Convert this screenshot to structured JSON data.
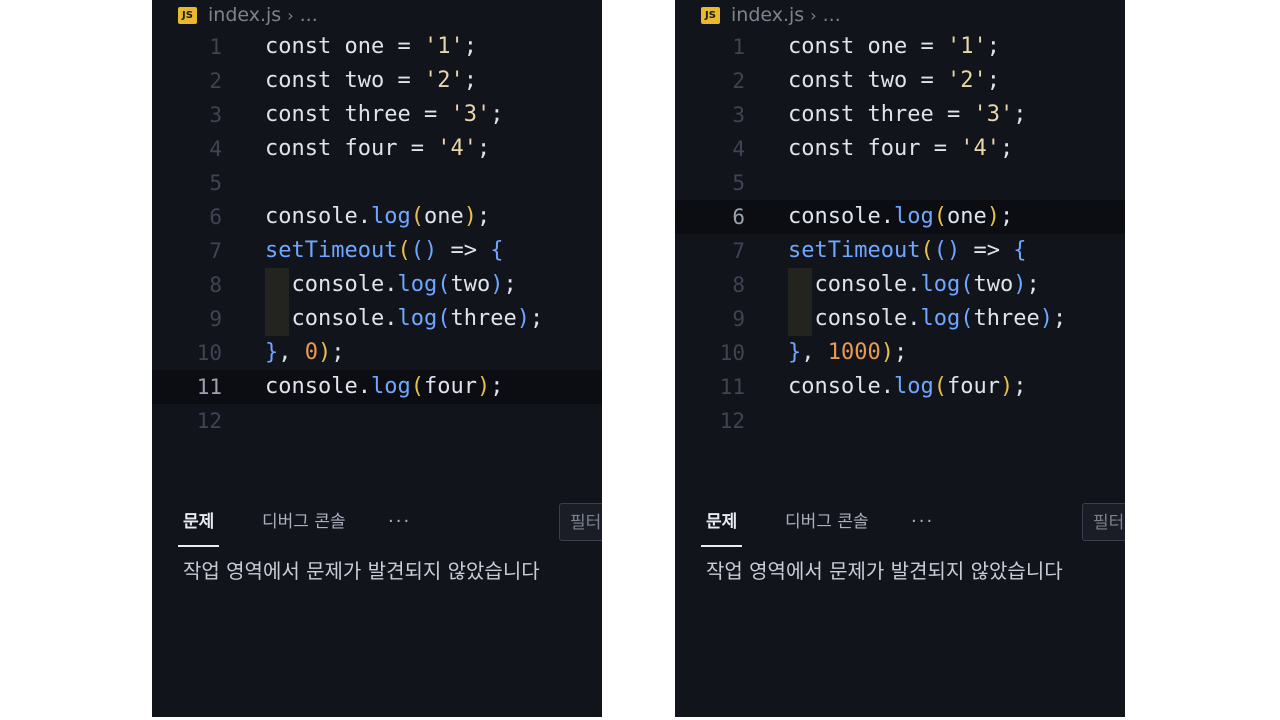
{
  "editors": [
    {
      "breadcrumb": {
        "file": "index.js",
        "icon": "JS",
        "ellipsis": "..."
      },
      "current_line": 11,
      "lines": [
        {
          "n": "1",
          "parts": [
            [
              "const ",
              "key"
            ],
            [
              "one",
              "id"
            ],
            [
              " = ",
              "punc"
            ],
            [
              "'1'",
              "str"
            ],
            [
              ";",
              "punc"
            ]
          ]
        },
        {
          "n": "2",
          "parts": [
            [
              "const ",
              "key"
            ],
            [
              "two",
              "id"
            ],
            [
              " = ",
              "punc"
            ],
            [
              "'2'",
              "str"
            ],
            [
              ";",
              "punc"
            ]
          ]
        },
        {
          "n": "3",
          "parts": [
            [
              "const ",
              "key"
            ],
            [
              "three",
              "id"
            ],
            [
              " = ",
              "punc"
            ],
            [
              "'3'",
              "str"
            ],
            [
              ";",
              "punc"
            ]
          ]
        },
        {
          "n": "4",
          "parts": [
            [
              "const ",
              "key"
            ],
            [
              "four",
              "id"
            ],
            [
              " = ",
              "punc"
            ],
            [
              "'4'",
              "str"
            ],
            [
              ";",
              "punc"
            ]
          ]
        },
        {
          "n": "5",
          "parts": []
        },
        {
          "n": "6",
          "parts": [
            [
              "console",
              "id"
            ],
            [
              ".",
              "punc"
            ],
            [
              "log",
              "fn"
            ],
            [
              "(",
              "paren"
            ],
            [
              "one",
              "id"
            ],
            [
              ")",
              "paren"
            ],
            [
              ";",
              "punc"
            ]
          ]
        },
        {
          "n": "7",
          "parts": [
            [
              "setTimeout",
              "fn"
            ],
            [
              "(",
              "paren"
            ],
            [
              "()",
              "paren2"
            ],
            [
              " => ",
              "punc"
            ],
            [
              "{",
              "paren2"
            ]
          ]
        },
        {
          "n": "8",
          "indent": true,
          "parts": [
            [
              "  console",
              "id"
            ],
            [
              ".",
              "punc"
            ],
            [
              "log",
              "fn"
            ],
            [
              "(",
              "paren2"
            ],
            [
              "two",
              "id"
            ],
            [
              ")",
              "paren2"
            ],
            [
              ";",
              "punc"
            ]
          ]
        },
        {
          "n": "9",
          "indent": true,
          "parts": [
            [
              "  console",
              "id"
            ],
            [
              ".",
              "punc"
            ],
            [
              "log",
              "fn"
            ],
            [
              "(",
              "paren2"
            ],
            [
              "three",
              "id"
            ],
            [
              ")",
              "paren2"
            ],
            [
              ";",
              "punc"
            ]
          ]
        },
        {
          "n": "10",
          "parts": [
            [
              "}",
              "paren2"
            ],
            [
              ", ",
              "punc"
            ],
            [
              "0",
              "num"
            ],
            [
              ")",
              "paren"
            ],
            [
              ";",
              "punc"
            ]
          ]
        },
        {
          "n": "11",
          "parts": [
            [
              "console",
              "id"
            ],
            [
              ".",
              "punc"
            ],
            [
              "log",
              "fn"
            ],
            [
              "(",
              "paren"
            ],
            [
              "four",
              "id"
            ],
            [
              ")",
              "paren"
            ],
            [
              ";",
              "punc"
            ]
          ]
        },
        {
          "n": "12",
          "parts": []
        }
      ],
      "panel": {
        "tabs": [
          "문제",
          "디버그 콘솔",
          "···"
        ],
        "active_tab": "문제",
        "filter_placeholder": "필터",
        "message": "작업 영역에서 문제가 발견되지 않았습니다"
      }
    },
    {
      "breadcrumb": {
        "file": "index.js",
        "icon": "JS",
        "ellipsis": "..."
      },
      "current_line": 6,
      "lines": [
        {
          "n": "1",
          "parts": [
            [
              "const ",
              "key"
            ],
            [
              "one",
              "id"
            ],
            [
              " = ",
              "punc"
            ],
            [
              "'1'",
              "str"
            ],
            [
              ";",
              "punc"
            ]
          ]
        },
        {
          "n": "2",
          "parts": [
            [
              "const ",
              "key"
            ],
            [
              "two",
              "id"
            ],
            [
              " = ",
              "punc"
            ],
            [
              "'2'",
              "str"
            ],
            [
              ";",
              "punc"
            ]
          ]
        },
        {
          "n": "3",
          "parts": [
            [
              "const ",
              "key"
            ],
            [
              "three",
              "id"
            ],
            [
              " = ",
              "punc"
            ],
            [
              "'3'",
              "str"
            ],
            [
              ";",
              "punc"
            ]
          ]
        },
        {
          "n": "4",
          "parts": [
            [
              "const ",
              "key"
            ],
            [
              "four",
              "id"
            ],
            [
              " = ",
              "punc"
            ],
            [
              "'4'",
              "str"
            ],
            [
              ";",
              "punc"
            ]
          ]
        },
        {
          "n": "5",
          "parts": []
        },
        {
          "n": "6",
          "parts": [
            [
              "console",
              "id"
            ],
            [
              ".",
              "punc"
            ],
            [
              "log",
              "fn"
            ],
            [
              "(",
              "paren"
            ],
            [
              "one",
              "id"
            ],
            [
              ")",
              "paren"
            ],
            [
              ";",
              "punc"
            ]
          ]
        },
        {
          "n": "7",
          "parts": [
            [
              "setTimeout",
              "fn"
            ],
            [
              "(",
              "paren"
            ],
            [
              "()",
              "paren2"
            ],
            [
              " => ",
              "punc"
            ],
            [
              "{",
              "paren2"
            ]
          ]
        },
        {
          "n": "8",
          "indent": true,
          "parts": [
            [
              "  console",
              "id"
            ],
            [
              ".",
              "punc"
            ],
            [
              "log",
              "fn"
            ],
            [
              "(",
              "paren2"
            ],
            [
              "two",
              "id"
            ],
            [
              ")",
              "paren2"
            ],
            [
              ";",
              "punc"
            ]
          ]
        },
        {
          "n": "9",
          "indent": true,
          "parts": [
            [
              "  console",
              "id"
            ],
            [
              ".",
              "punc"
            ],
            [
              "log",
              "fn"
            ],
            [
              "(",
              "paren2"
            ],
            [
              "three",
              "id"
            ],
            [
              ")",
              "paren2"
            ],
            [
              ";",
              "punc"
            ]
          ]
        },
        {
          "n": "10",
          "parts": [
            [
              "}",
              "paren2"
            ],
            [
              ", ",
              "punc"
            ],
            [
              "1000",
              "num"
            ],
            [
              ")",
              "paren"
            ],
            [
              ";",
              "punc"
            ]
          ]
        },
        {
          "n": "11",
          "parts": [
            [
              "console",
              "id"
            ],
            [
              ".",
              "punc"
            ],
            [
              "log",
              "fn"
            ],
            [
              "(",
              "paren"
            ],
            [
              "four",
              "id"
            ],
            [
              ")",
              "paren"
            ],
            [
              ";",
              "punc"
            ]
          ]
        },
        {
          "n": "12",
          "parts": []
        }
      ],
      "panel": {
        "tabs": [
          "문제",
          "디버그 콘솔",
          "···"
        ],
        "active_tab": "문제",
        "filter_placeholder": "필터",
        "message": "작업 영역에서 문제가 발견되지 않았습니다"
      }
    }
  ]
}
